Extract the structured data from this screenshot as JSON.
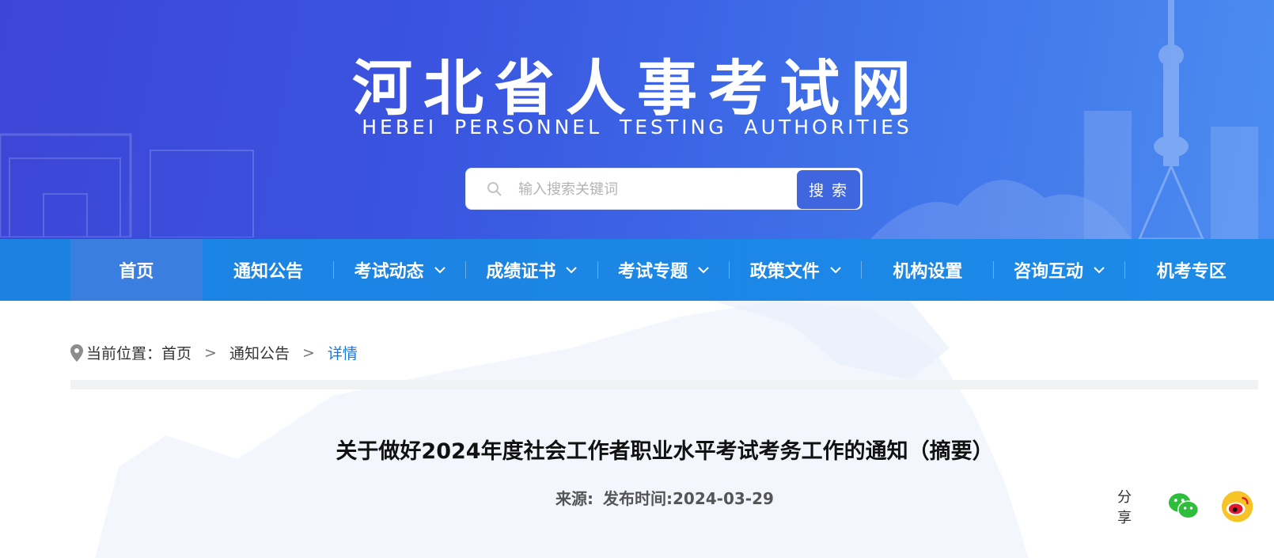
{
  "header": {
    "title": "河北省人事考试网",
    "subtitle": "HEBEI  PERSONNEL  TESTING AUTHORITIES",
    "search_placeholder": "输入搜索关键词",
    "search_button": "搜 索"
  },
  "nav": {
    "items": [
      {
        "label": "首页",
        "active": true,
        "dropdown": false
      },
      {
        "label": "通知公告",
        "active": false,
        "dropdown": false
      },
      {
        "label": "考试动态",
        "active": false,
        "dropdown": true
      },
      {
        "label": "成绩证书",
        "active": false,
        "dropdown": true
      },
      {
        "label": "考试专题",
        "active": false,
        "dropdown": true
      },
      {
        "label": "政策文件",
        "active": false,
        "dropdown": true
      },
      {
        "label": "机构设置",
        "active": false,
        "dropdown": false
      },
      {
        "label": "咨询互动",
        "active": false,
        "dropdown": true
      },
      {
        "label": "机考专区",
        "active": false,
        "dropdown": false
      }
    ]
  },
  "breadcrumb": {
    "prefix": "当前位置：",
    "items": [
      "首页",
      "通知公告"
    ],
    "current": "详情",
    "separator": ">"
  },
  "article": {
    "title": "关于做好2024年度社会工作者职业水平考试考务工作的通知（摘要）",
    "source_label": "来源:",
    "published": "发布时间:2024-03-29"
  },
  "share": {
    "label": "分享",
    "icons": [
      "wechat-icon",
      "weibo-icon"
    ]
  },
  "colors": {
    "banner": "#3d45d6",
    "nav": "#1b82e2",
    "nav_active": "#3a7ee0",
    "search_button": "#3f66df",
    "breadcrumb_current": "#1a7ad8"
  }
}
